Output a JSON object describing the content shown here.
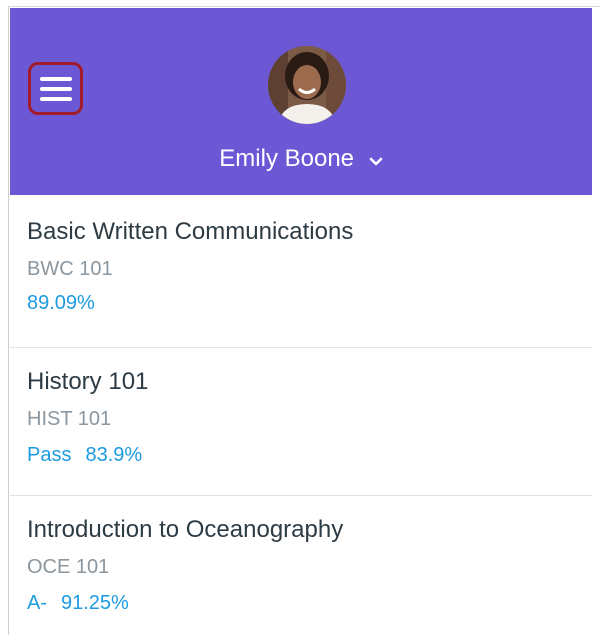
{
  "header": {
    "user_name": "Emily Boone",
    "background_color": "#6c58d5",
    "menu_icon": "hamburger-icon",
    "dropdown_icon": "chevron-down-icon",
    "highlight_color": "#a21b2a"
  },
  "courses": [
    {
      "title": "Basic Written Communications",
      "code": "BWC 101",
      "letter": "",
      "grade": "89.09%"
    },
    {
      "title": "History 101",
      "code": "HIST 101",
      "letter": "Pass",
      "grade": "83.9%"
    },
    {
      "title": "Introduction to Oceanography",
      "code": "OCE 101",
      "letter": "A-",
      "grade": "91.25%"
    }
  ],
  "colors": {
    "title": "#2d3b45",
    "code": "#8b969e",
    "grade": "#1c9be0"
  }
}
